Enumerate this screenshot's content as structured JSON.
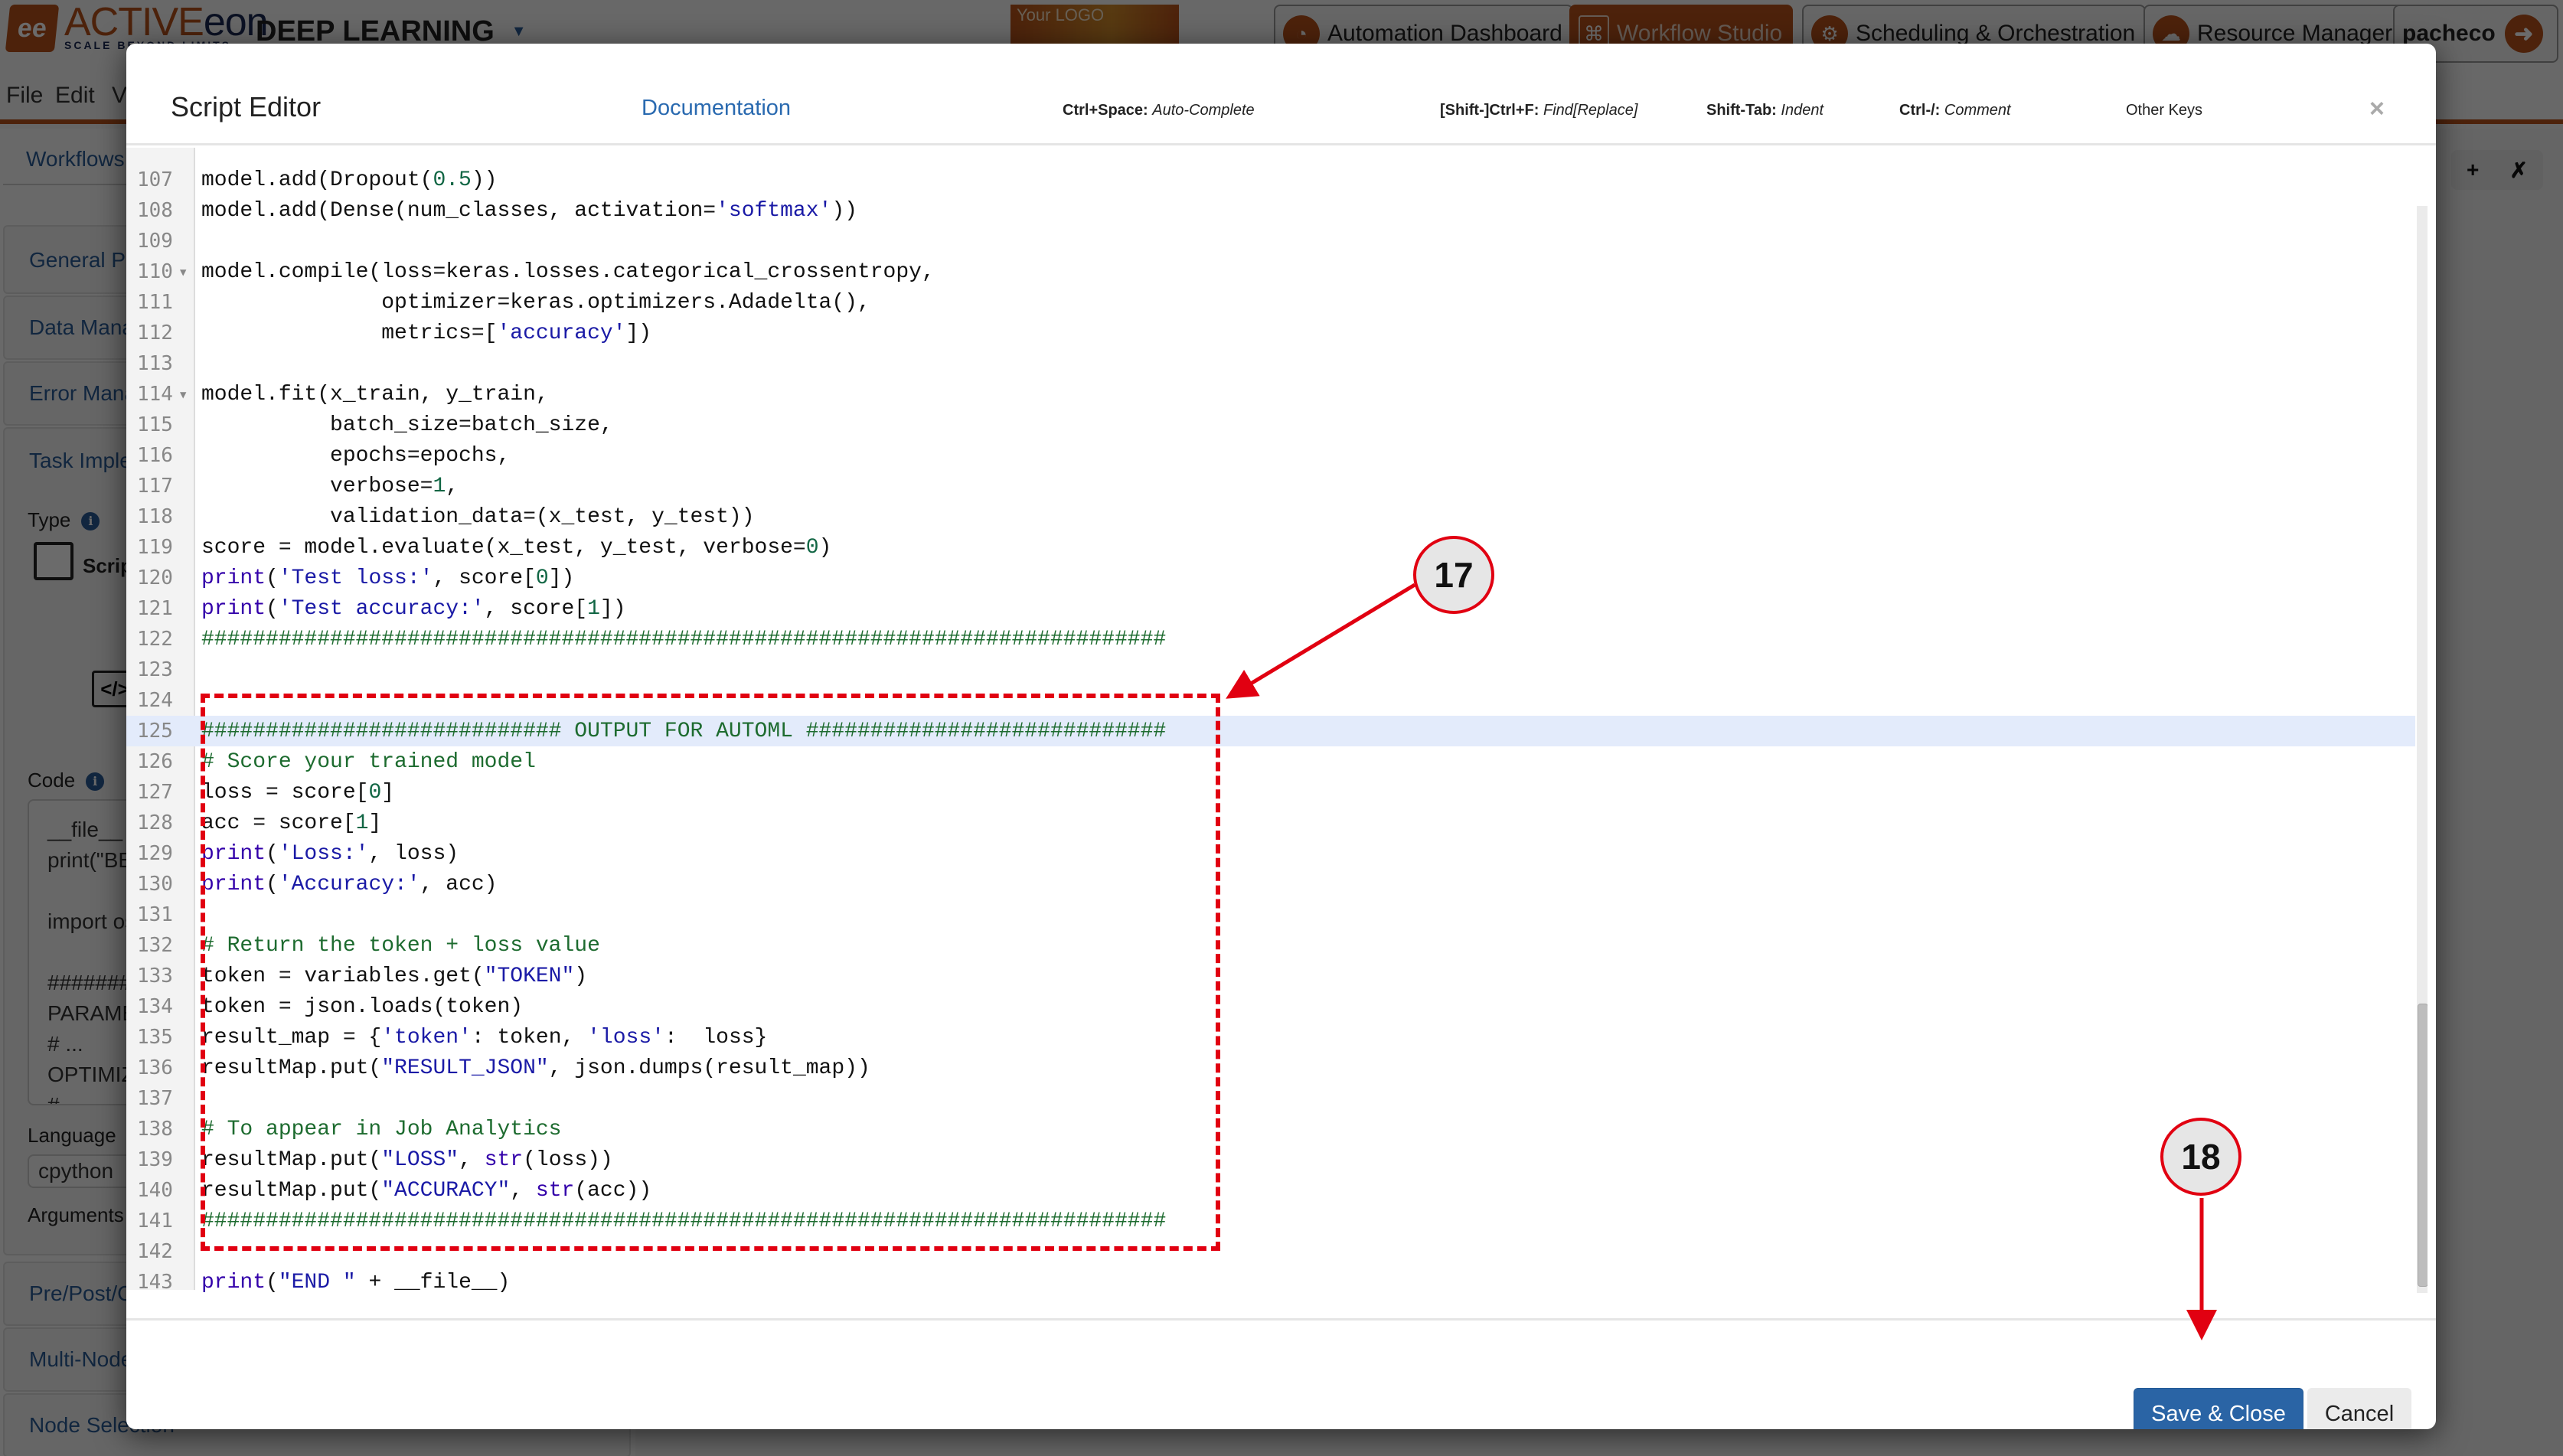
{
  "app": {
    "brand_mark": "ee",
    "brand_name_1": "ACTIVE",
    "brand_name_2": "eon",
    "brand_tagline": "SCALE BEYOND LIMITS",
    "product": "DEEP LEARNING",
    "your_logo": "Your LOGO",
    "portals": [
      {
        "label": "Automation Dashboard",
        "active": false
      },
      {
        "label": "Workflow Studio",
        "active": true
      },
      {
        "label": "Scheduling & Orchestration",
        "active": false
      },
      {
        "label": "Resource Manager",
        "active": false
      }
    ],
    "user": "pacheco",
    "menu": [
      "File",
      "Edit",
      "View"
    ],
    "workflows_link": "Workflows"
  },
  "task_panel": {
    "sections": [
      "General Parameters",
      "Data Management",
      "Error Management",
      "Task Implementation",
      "Pre/Post/Clean",
      "Multi-Node",
      "Node Selection"
    ],
    "type_label": "Type",
    "type_value": "Script",
    "code_label": "Code",
    "code_preview": "__file__ = \nprint(\"BEGIN \" + __file__)\n\nimport os\n\n##########\nPARAMETERS\n# ...\nOPTIMIZER\n#",
    "language_label": "Language",
    "language_value": "cpython",
    "arguments_label": "Arguments"
  },
  "right_tools": {
    "add": "+",
    "pin": "✗"
  },
  "modal": {
    "title": "Script Editor",
    "documentation_link": "Documentation",
    "shortcuts": [
      {
        "key": "Ctrl+Space:",
        "action": "Auto-Complete"
      },
      {
        "key": "[Shift-]Ctrl+F:",
        "action": "Find[Replace]"
      },
      {
        "key": "Shift-Tab:",
        "action": "Indent"
      },
      {
        "key": "Ctrl-/:",
        "action": "Comment"
      }
    ],
    "other_keys": "Other Keys",
    "close": "×",
    "save_button": "Save & Close",
    "cancel_button": "Cancel",
    "active_line": 125,
    "code_lines": [
      {
        "n": 107,
        "tokens": [
          [
            "t",
            "model.add(Dropout("
          ],
          [
            "num",
            "0.5"
          ],
          [
            "t",
            "))"
          ]
        ]
      },
      {
        "n": 108,
        "tokens": [
          [
            "t",
            "model.add(Dense(num_classes, activation="
          ],
          [
            "str",
            "'softmax'"
          ],
          [
            "t",
            "))"
          ]
        ]
      },
      {
        "n": 109,
        "tokens": []
      },
      {
        "n": 110,
        "fold": true,
        "tokens": [
          [
            "t",
            "model.compile(loss=keras.losses.categorical_crossentropy,"
          ]
        ]
      },
      {
        "n": 111,
        "tokens": [
          [
            "t",
            "              optimizer=keras.optimizers.Adadelta(),"
          ]
        ]
      },
      {
        "n": 112,
        "tokens": [
          [
            "t",
            "              metrics=["
          ],
          [
            "str",
            "'accuracy'"
          ],
          [
            "t",
            "])"
          ]
        ]
      },
      {
        "n": 113,
        "tokens": []
      },
      {
        "n": 114,
        "fold": true,
        "tokens": [
          [
            "t",
            "model.fit(x_train, y_train,"
          ]
        ]
      },
      {
        "n": 115,
        "tokens": [
          [
            "t",
            "          batch_size=batch_size,"
          ]
        ]
      },
      {
        "n": 116,
        "tokens": [
          [
            "t",
            "          epochs=epochs,"
          ]
        ]
      },
      {
        "n": 117,
        "tokens": [
          [
            "t",
            "          verbose="
          ],
          [
            "num",
            "1"
          ],
          [
            "t",
            ","
          ]
        ]
      },
      {
        "n": 118,
        "tokens": [
          [
            "t",
            "          validation_data=(x_test, y_test))"
          ]
        ]
      },
      {
        "n": 119,
        "tokens": [
          [
            "t",
            "score = model.evaluate(x_test, y_test, verbose="
          ],
          [
            "num",
            "0"
          ],
          [
            "t",
            ")"
          ]
        ]
      },
      {
        "n": 120,
        "tokens": [
          [
            "kw",
            "print"
          ],
          [
            "t",
            "("
          ],
          [
            "str",
            "'Test loss:'"
          ],
          [
            "t",
            ", score["
          ],
          [
            "num",
            "0"
          ],
          [
            "t",
            "])"
          ]
        ]
      },
      {
        "n": 121,
        "tokens": [
          [
            "kw",
            "print"
          ],
          [
            "t",
            "("
          ],
          [
            "str",
            "'Test accuracy:'"
          ],
          [
            "t",
            ", score["
          ],
          [
            "num",
            "1"
          ],
          [
            "t",
            "])"
          ]
        ]
      },
      {
        "n": 122,
        "tokens": [
          [
            "com",
            "###########################################################################"
          ]
        ]
      },
      {
        "n": 123,
        "tokens": []
      },
      {
        "n": 124,
        "tokens": []
      },
      {
        "n": 125,
        "tokens": [
          [
            "com",
            "############################ OUTPUT FOR AUTOML ############################"
          ]
        ]
      },
      {
        "n": 126,
        "tokens": [
          [
            "com",
            "# Score your trained model"
          ]
        ]
      },
      {
        "n": 127,
        "tokens": [
          [
            "t",
            "loss = score["
          ],
          [
            "num",
            "0"
          ],
          [
            "t",
            "]"
          ]
        ]
      },
      {
        "n": 128,
        "tokens": [
          [
            "t",
            "acc = score["
          ],
          [
            "num",
            "1"
          ],
          [
            "t",
            "]"
          ]
        ]
      },
      {
        "n": 129,
        "tokens": [
          [
            "kw",
            "print"
          ],
          [
            "t",
            "("
          ],
          [
            "str",
            "'Loss:'"
          ],
          [
            "t",
            ", loss)"
          ]
        ]
      },
      {
        "n": 130,
        "tokens": [
          [
            "kw",
            "print"
          ],
          [
            "t",
            "("
          ],
          [
            "str",
            "'Accuracy:'"
          ],
          [
            "t",
            ", acc)"
          ]
        ]
      },
      {
        "n": 131,
        "tokens": []
      },
      {
        "n": 132,
        "tokens": [
          [
            "com",
            "# Return the token + loss value"
          ]
        ]
      },
      {
        "n": 133,
        "tokens": [
          [
            "t",
            "token = variables.get("
          ],
          [
            "str",
            "\"TOKEN\""
          ],
          [
            "t",
            ")"
          ]
        ]
      },
      {
        "n": 134,
        "tokens": [
          [
            "t",
            "token = json.loads(token)"
          ]
        ]
      },
      {
        "n": 135,
        "tokens": [
          [
            "t",
            "result_map = {"
          ],
          [
            "str",
            "'token'"
          ],
          [
            "t",
            ": token, "
          ],
          [
            "str",
            "'loss'"
          ],
          [
            "t",
            ":  loss}"
          ]
        ]
      },
      {
        "n": 136,
        "tokens": [
          [
            "t",
            "resultMap.put("
          ],
          [
            "str",
            "\"RESULT_JSON\""
          ],
          [
            "t",
            ", json.dumps(result_map))"
          ]
        ]
      },
      {
        "n": 137,
        "tokens": []
      },
      {
        "n": 138,
        "tokens": [
          [
            "com",
            "# To appear in Job Analytics"
          ]
        ]
      },
      {
        "n": 139,
        "tokens": [
          [
            "t",
            "resultMap.put("
          ],
          [
            "str",
            "\"LOSS\""
          ],
          [
            "t",
            ", "
          ],
          [
            "kw",
            "str"
          ],
          [
            "t",
            "(loss))"
          ]
        ]
      },
      {
        "n": 140,
        "tokens": [
          [
            "t",
            "resultMap.put("
          ],
          [
            "str",
            "\"ACCURACY\""
          ],
          [
            "t",
            ", "
          ],
          [
            "kw",
            "str"
          ],
          [
            "t",
            "(acc))"
          ]
        ]
      },
      {
        "n": 141,
        "tokens": [
          [
            "com",
            "###########################################################################"
          ]
        ]
      },
      {
        "n": 142,
        "tokens": []
      },
      {
        "n": 143,
        "tokens": [
          [
            "kw",
            "print"
          ],
          [
            "t",
            "("
          ],
          [
            "str",
            "\"END \""
          ],
          [
            "t",
            " + __file__)"
          ]
        ]
      }
    ]
  },
  "annotations": [
    {
      "number": "17",
      "target": "automl-output-block"
    },
    {
      "number": "18",
      "target": "save-close-button"
    }
  ],
  "colors": {
    "brand_orange": "#b8521b",
    "primary_button": "#2a64a5",
    "annotation_red": "#e10011",
    "string_token": "#1a1aa6",
    "number_token": "#116644",
    "comment_token": "#1d6b2f",
    "active_line_bg": "#e3ebfb"
  }
}
